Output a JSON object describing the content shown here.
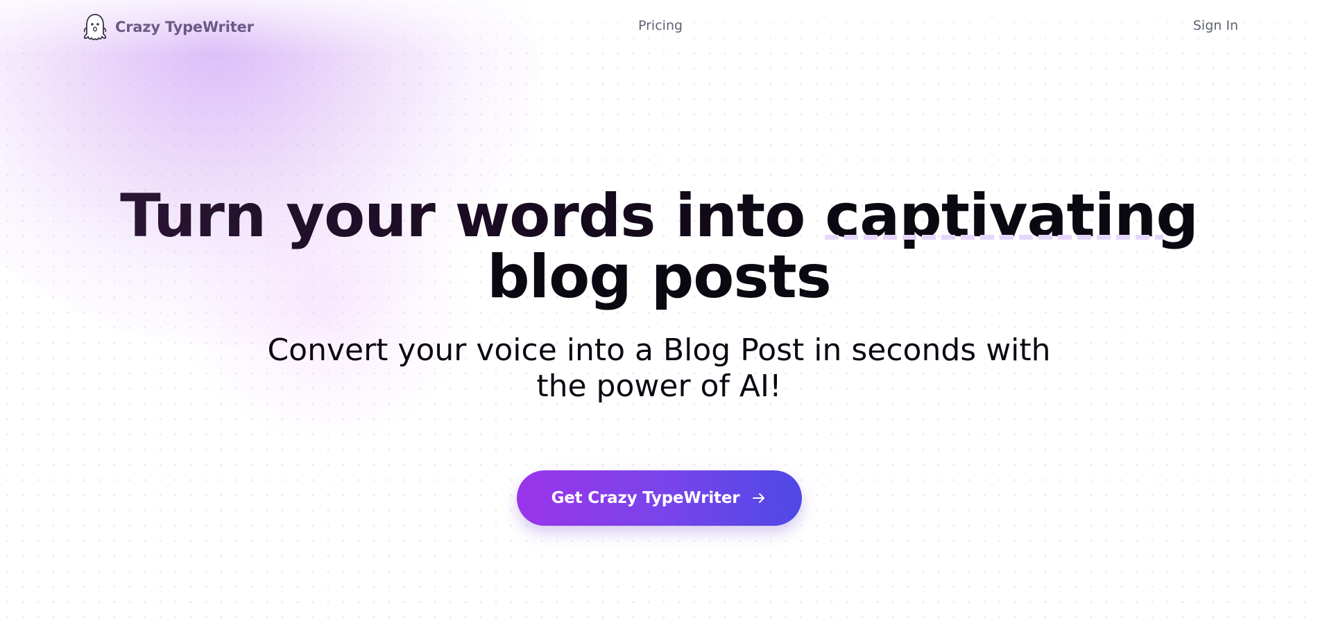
{
  "nav": {
    "brand_name": "Crazy TypeWriter",
    "brand_icon": "ghost-icon",
    "links": [
      {
        "label": "Pricing"
      },
      {
        "label": "Sign In"
      }
    ]
  },
  "hero": {
    "title_lead": "Turn your words into ",
    "title_accent": "captivating",
    "title_line2": "blog posts",
    "subtitle_line1": "Convert your voice into a Blog Post in seconds with",
    "subtitle_line2": "the power of AI!"
  },
  "cta": {
    "label": "Get Crazy TypeWriter",
    "icon": "arrow-right-icon",
    "gradient": [
      "#9a34ea",
      "#4f48e6"
    ]
  },
  "colors": {
    "glow": "#d6b4f5",
    "text_dark": "#0c0812",
    "brand_text": "#6a5a86",
    "nav_text": "#5f6472",
    "underline": "#e6d6fb"
  }
}
